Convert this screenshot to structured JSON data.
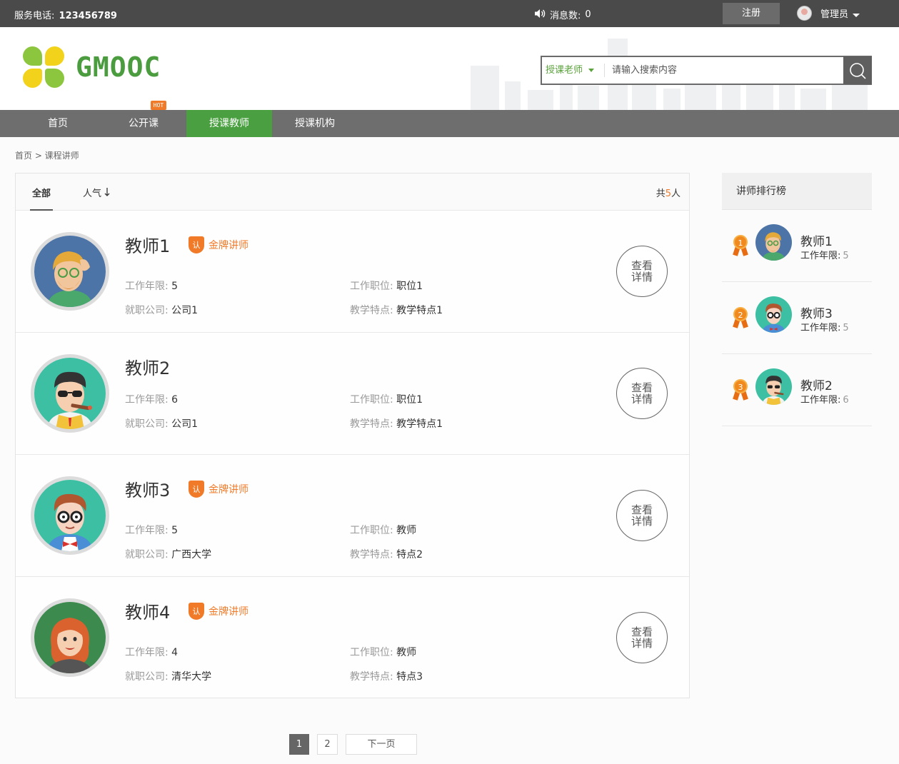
{
  "topbar": {
    "phone_label": "服务电话:",
    "phone_number": "123456789",
    "msg_label": "消息数:",
    "msg_count": "0",
    "register": "注册",
    "user": "管理员"
  },
  "brand": "GMOOC",
  "search": {
    "type": "授课老师",
    "placeholder": "请输入搜索内容"
  },
  "nav": [
    {
      "label": "首页"
    },
    {
      "label": "公开课"
    },
    {
      "label": "授课教师"
    },
    {
      "label": "授课机构"
    }
  ],
  "hot_badge": "HOT",
  "breadcrumb": "首页 > 课程讲师",
  "list": {
    "tab_all": "全部",
    "tab_popular": "人气",
    "total_prefix": "共",
    "total_count": "5",
    "total_suffix": "人",
    "detail_label": "查看详情",
    "labels": {
      "years": "工作年限:",
      "position": "工作职位:",
      "company": "就职公司:",
      "feature": "教学特点:"
    },
    "gold_badge": "金牌讲师",
    "gold_icon_char": "认",
    "teachers": [
      {
        "name": "教师1",
        "gold": true,
        "years": "5",
        "position": "职位1",
        "company": "公司1",
        "feature": "教学特点1",
        "avatar": "bearded-man-glasses"
      },
      {
        "name": "教师2",
        "gold": false,
        "years": "6",
        "position": "职位1",
        "company": "公司1",
        "feature": "教学特点1",
        "avatar": "man-sunglasses-cigar"
      },
      {
        "name": "教师3",
        "gold": true,
        "years": "5",
        "position": "教师",
        "company": "广西大学",
        "feature": "特点2",
        "avatar": "man-glasses-bowtie"
      },
      {
        "name": "教师4",
        "gold": true,
        "years": "4",
        "position": "教师",
        "company": "清华大学",
        "feature": "特点3",
        "avatar": "woman-red-hair"
      }
    ]
  },
  "pager": {
    "pages": [
      "1",
      "2"
    ],
    "current": "1",
    "next": "下一页"
  },
  "ranking": {
    "title": "讲师排行榜",
    "years_label": "工作年限:",
    "items": [
      {
        "rank": "1",
        "name": "教师1",
        "years": "5"
      },
      {
        "rank": "2",
        "name": "教师3",
        "years": "5"
      },
      {
        "rank": "3",
        "name": "教师2",
        "years": "6"
      }
    ]
  },
  "colors": {
    "accent_green": "#4aa041",
    "accent_orange": "#f07a27",
    "topbar": "#4a4a4a",
    "nav": "#6e6e6e"
  }
}
